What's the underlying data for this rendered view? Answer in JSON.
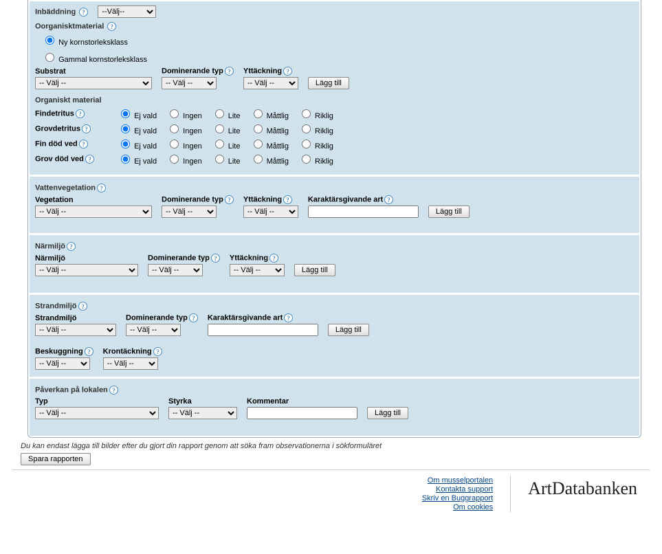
{
  "common": {
    "select_default": "-- Välj --",
    "select_default_compact": "--Välj--",
    "add_btn": "Lägg till",
    "radio_options": [
      "Ej vald",
      "Ingen",
      "Lite",
      "Måttlig",
      "Riklig"
    ]
  },
  "inbaddning": {
    "label": "Inbäddning"
  },
  "oorganiskt": {
    "header": "Oorganisktmaterial",
    "radio_new": "Ny kornstorleksklass",
    "radio_old": "Gammal kornstorleksklass",
    "substrat_label": "Substrat",
    "dom_label": "Dominerande typ",
    "ytt_label": "Yttäckning"
  },
  "organiskt": {
    "header": "Organiskt material",
    "rows": [
      "Findetritus",
      "Grovdetritus",
      "Fin död ved",
      "Grov död ved"
    ]
  },
  "vatten": {
    "header": "Vattenvegetation",
    "veg_label": "Vegetation",
    "dom_label": "Dominerande typ",
    "ytt_label": "Yttäckning",
    "kar_label": "Karaktärsgivande art"
  },
  "narmiljo": {
    "header": "Närmiljö",
    "nar_label": "Närmiljö",
    "dom_label": "Dominerande typ",
    "ytt_label": "Yttäckning"
  },
  "strand": {
    "header": "Strandmiljö",
    "str_label": "Strandmiljö",
    "dom_label": "Dominerande typ",
    "kar_label": "Karaktärsgivande art",
    "besk_label": "Beskuggning",
    "kron_label": "Krontäckning"
  },
  "paverkan": {
    "header": "Påverkan på lokalen",
    "typ_label": "Typ",
    "styrka_label": "Styrka",
    "kommentar_label": "Kommentar"
  },
  "note": "Du kan endast lägga till bilder efter du gjort din rapport genom att söka fram observationerna i sökformuläret",
  "save_btn": "Spara rapporten",
  "footer": {
    "links": [
      "Om musselportalen",
      "Kontakta support",
      "Skriv en Buggrapport",
      "Om cookies"
    ],
    "brand": "ArtDatabanken"
  }
}
